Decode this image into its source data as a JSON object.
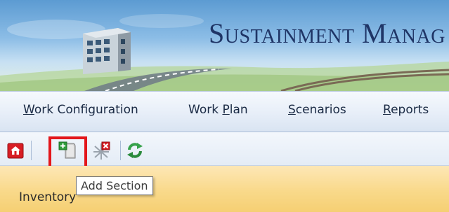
{
  "header": {
    "app_title": "Sustainment Manag",
    "logo_icon": "building-road-logo"
  },
  "menu": {
    "items": [
      {
        "pre": "",
        "ul": "W",
        "post": "ork Configuration"
      },
      {
        "pre": "Work ",
        "ul": "P",
        "post": "lan"
      },
      {
        "pre": "",
        "ul": "S",
        "post": "cenarios"
      },
      {
        "pre": "",
        "ul": "R",
        "post": "eports"
      }
    ]
  },
  "toolbar": {
    "buttons": [
      {
        "icon": "home-icon"
      },
      {
        "icon": "add-section-icon"
      },
      {
        "icon": "delete-section-icon"
      },
      {
        "icon": "refresh-icon"
      }
    ],
    "tooltip": "Add Section",
    "highlight_color": "#e3161b"
  },
  "panel": {
    "title": "Inventory"
  },
  "colors": {
    "menubar_bg": "#e7eef8",
    "panel_bg": "#f9d98a",
    "banner_title": "#1f3566"
  }
}
